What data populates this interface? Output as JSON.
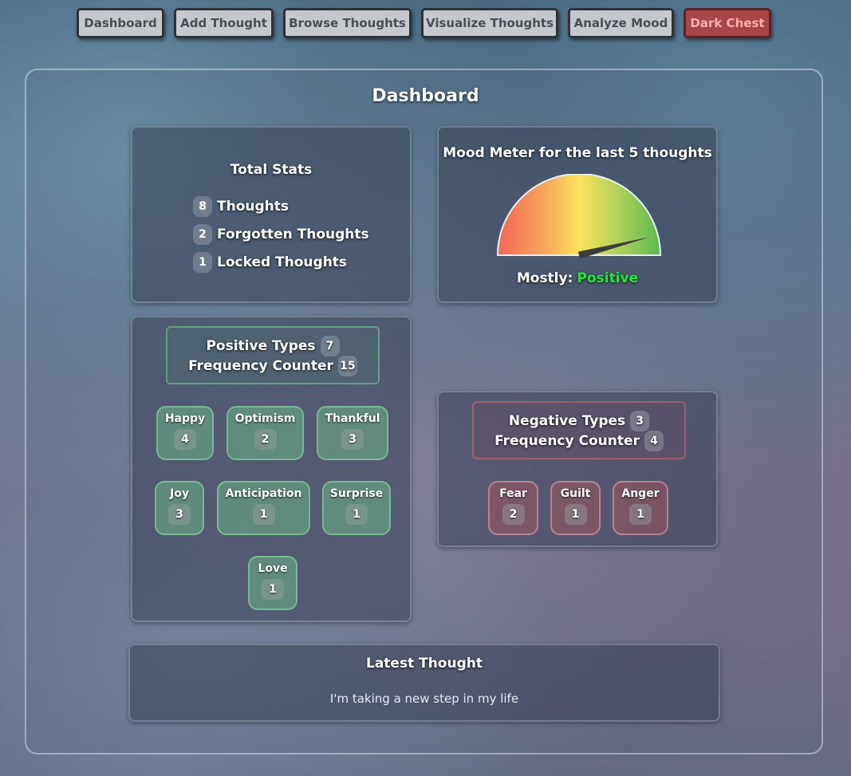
{
  "nav": {
    "items": [
      {
        "label": "Dashboard"
      },
      {
        "label": "Add Thought"
      },
      {
        "label": "Browse Thoughts"
      },
      {
        "label": "Visualize Thoughts"
      },
      {
        "label": "Analyze Mood"
      },
      {
        "label": "Dark Chest"
      }
    ]
  },
  "page": {
    "title": "Dashboard"
  },
  "total_stats": {
    "title": "Total Stats",
    "rows": [
      {
        "count": "8",
        "label": "Thoughts"
      },
      {
        "count": "2",
        "label": "Forgotten Thoughts"
      },
      {
        "count": "1",
        "label": "Locked Thoughts"
      }
    ]
  },
  "mood_meter": {
    "title": "Mood Meter for the last 5 thoughts",
    "prefix": "Mostly:",
    "value": "Positive",
    "value_color": "#22e83a",
    "needle_fraction": 0.92
  },
  "positive": {
    "types_label": "Positive Types",
    "types_count": "7",
    "freq_label": "Frequency Counter",
    "freq_count": "15",
    "items": [
      {
        "label": "Happy",
        "count": "4"
      },
      {
        "label": "Optimism",
        "count": "2"
      },
      {
        "label": "Thankful",
        "count": "3"
      },
      {
        "label": "Joy",
        "count": "3"
      },
      {
        "label": "Anticipation",
        "count": "1"
      },
      {
        "label": "Surprise",
        "count": "1"
      },
      {
        "label": "Love",
        "count": "1"
      }
    ]
  },
  "negative": {
    "types_label": "Negative Types",
    "types_count": "3",
    "freq_label": "Frequency Counter",
    "freq_count": "4",
    "items": [
      {
        "label": "Fear",
        "count": "2"
      },
      {
        "label": "Guilt",
        "count": "1"
      },
      {
        "label": "Anger",
        "count": "1"
      }
    ]
  },
  "latest": {
    "title": "Latest Thought",
    "text": "I'm taking a new step in my life"
  }
}
